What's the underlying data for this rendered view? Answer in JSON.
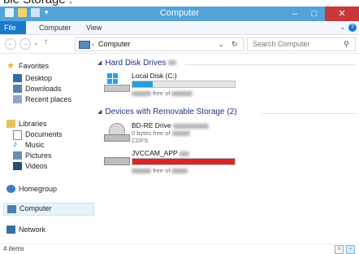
{
  "page_top_text": "ble Storage :",
  "window": {
    "title": "Computer"
  },
  "ribbon": {
    "tabs": [
      "File",
      "Computer",
      "View"
    ]
  },
  "address": {
    "breadcrumb": "Computer",
    "search_placeholder": "Search Computer"
  },
  "nav": {
    "favorites": "Favorites",
    "desktop": "Desktop",
    "downloads": "Downloads",
    "recent": "Recent places",
    "libraries": "Libraries",
    "documents": "Documents",
    "music": "Music",
    "pictures": "Pictures",
    "videos": "Videos",
    "homegroup": "Homegroup",
    "computer": "Computer",
    "network": "Network"
  },
  "groups": {
    "hdd": {
      "title": "Hard Disk Drives"
    },
    "removable": {
      "title": "Devices with Removable Storage (2)"
    }
  },
  "drives": {
    "local": {
      "name": "Local Disk (C:)",
      "free_label": "free of",
      "usage": 0.2,
      "color": "#26a0da"
    },
    "bd": {
      "name": "BD-RE Drive",
      "status": "0 bytes free of",
      "fs": "CDFS"
    },
    "jvc": {
      "name": "JVCCAM_APP",
      "free_label": "free of",
      "usage": 1.0,
      "color": "#da2626"
    }
  },
  "status": {
    "count": "4 items"
  },
  "colors": {
    "titlebar": "#54a3d8",
    "file_tab": "#1979ca",
    "group_header": "#1e3287"
  }
}
